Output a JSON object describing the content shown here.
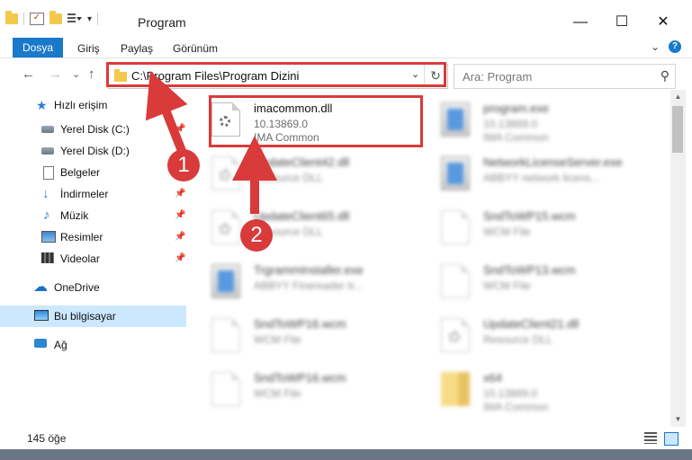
{
  "window": {
    "title": "Program",
    "minimize": "—",
    "maximize": "☐",
    "close": "✕"
  },
  "ribbon": {
    "tabs": [
      "Dosya",
      "Giriş",
      "Paylaş",
      "Görünüm"
    ],
    "collapse": "⌄",
    "help": "?"
  },
  "nav": {
    "back": "←",
    "forward": "→",
    "recent": "⌄",
    "up": "↑",
    "address": "C:\\Program Files\\Program Dizini",
    "address_dropdown": "⌄",
    "refresh": "↻",
    "search_placeholder": "Ara: Program",
    "search_icon": "⚲"
  },
  "sidebar": {
    "items": [
      {
        "label": "Hızlı erişim",
        "icon": "star-icon"
      },
      {
        "label": "Yerel Disk (C:)",
        "icon": "disk-icon",
        "pin": "📌"
      },
      {
        "label": "Yerel Disk (D:)",
        "icon": "disk-icon"
      },
      {
        "label": "Belgeler",
        "icon": "document-icon"
      },
      {
        "label": "İndirmeler",
        "icon": "download-icon",
        "pin": "📌"
      },
      {
        "label": "Müzik",
        "icon": "music-icon",
        "pin": "📌"
      },
      {
        "label": "Resimler",
        "icon": "pictures-icon",
        "pin": "📌"
      },
      {
        "label": "Videolar",
        "icon": "video-icon",
        "pin": "📌"
      },
      {
        "label": "OneDrive",
        "icon": "cloud-icon"
      },
      {
        "label": "Bu bilgisayar",
        "icon": "pc-icon",
        "selected": true
      },
      {
        "label": "Ağ",
        "icon": "network-icon"
      }
    ]
  },
  "files": [
    {
      "name": "imacommon.dll",
      "line1": "10.13869.0",
      "line2": "IMA Common",
      "icon": "dll-gear-icon",
      "highlighted": true
    },
    {
      "name": "program.exe",
      "line1": "10.13869.0",
      "line2": "IMA Common",
      "icon": "app-icon"
    },
    {
      "name": "UpdateClient42.dll",
      "line1": "Resource DLL",
      "icon": "dll-gear-icon"
    },
    {
      "name": "NetworkLicenseServer.exe",
      "line1": "ABBYY network licens...",
      "icon": "app-icon"
    },
    {
      "name": "UpdateClient65.dll",
      "line1": "Resource DLL",
      "icon": "dll-gear-icon"
    },
    {
      "name": "SndToWP15.wcm",
      "line1": "WCM File",
      "icon": "page-icon"
    },
    {
      "name": "TrgrammInstaller.exe",
      "line1": "ABBYY Finereader tr...",
      "icon": "app-icon"
    },
    {
      "name": "SndToWP13.wcm",
      "line1": "WCM File",
      "icon": "page-icon"
    },
    {
      "name": "SndToWP16.wcm",
      "line1": "WCM File",
      "icon": "page-icon"
    },
    {
      "name": "UpdateClient21.dll",
      "line1": "Resource DLL",
      "icon": "dll-gear-icon"
    },
    {
      "name": "SndToWP16.wcm",
      "line1": "WCM File",
      "icon": "page-icon"
    },
    {
      "name": "x64",
      "line1": "10.13869.0",
      "line2": "IMA Common",
      "icon": "archive-icon"
    }
  ],
  "callouts": [
    "1",
    "2"
  ],
  "status": {
    "count": "145 öğe"
  },
  "colors": {
    "accent": "#1979ca",
    "callout": "#d93a3a",
    "selection": "#cce8ff"
  }
}
